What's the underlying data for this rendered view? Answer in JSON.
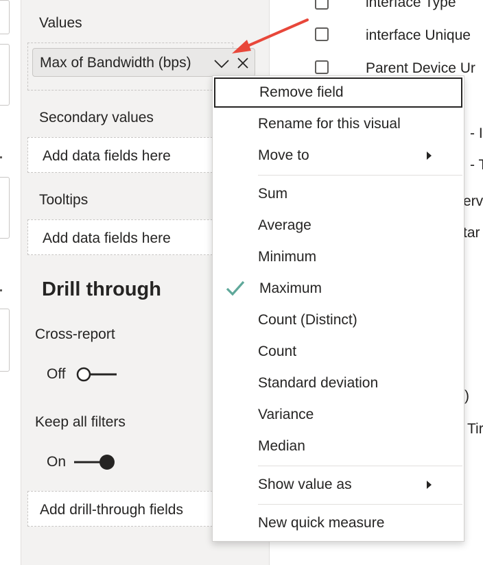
{
  "panel": {
    "values_label": "Values",
    "values_chip": "Max of Bandwidth (bps)",
    "secondary_values_label": "Secondary values",
    "secondary_placeholder": "Add data fields here",
    "tooltips_label": "Tooltips",
    "tooltips_placeholder": "Add data fields here",
    "drill_through_heading": "Drill through",
    "cross_report_label": "Cross-report",
    "cross_report_state": "Off",
    "keep_filters_label": "Keep all filters",
    "keep_filters_state": "On",
    "drill_placeholder": "Add drill-through fields"
  },
  "fields": [
    {
      "label": "interface Type",
      "checked": false
    },
    {
      "label": "interface Unique",
      "checked": false
    },
    {
      "label": "Parent Device Ur",
      "checked": false
    }
  ],
  "fields_fragments": [
    "- I",
    "- T",
    "erv",
    "tar",
    "r",
    ")",
    "Tir"
  ],
  "menu": {
    "items": [
      {
        "label": "Remove field",
        "focused": true
      },
      {
        "label": "Rename for this visual"
      },
      {
        "label": "Move to",
        "submenu": true
      },
      {
        "label": "Sum"
      },
      {
        "label": "Average"
      },
      {
        "label": "Minimum"
      },
      {
        "label": "Maximum",
        "checked": true
      },
      {
        "label": "Count (Distinct)"
      },
      {
        "label": "Count"
      },
      {
        "label": "Standard deviation"
      },
      {
        "label": "Variance"
      },
      {
        "label": "Median"
      },
      {
        "label": "Show value as",
        "submenu": true
      },
      {
        "label": "New quick measure"
      }
    ]
  },
  "colors": {
    "check": "#5fa89a",
    "annotation_arrow": "#e8473a",
    "panel_bg": "#f3f2f1"
  },
  "icons": [
    "chevron-down-icon",
    "close-icon",
    "checkmark-icon",
    "submenu-arrow-icon",
    "annotation-arrow"
  ]
}
